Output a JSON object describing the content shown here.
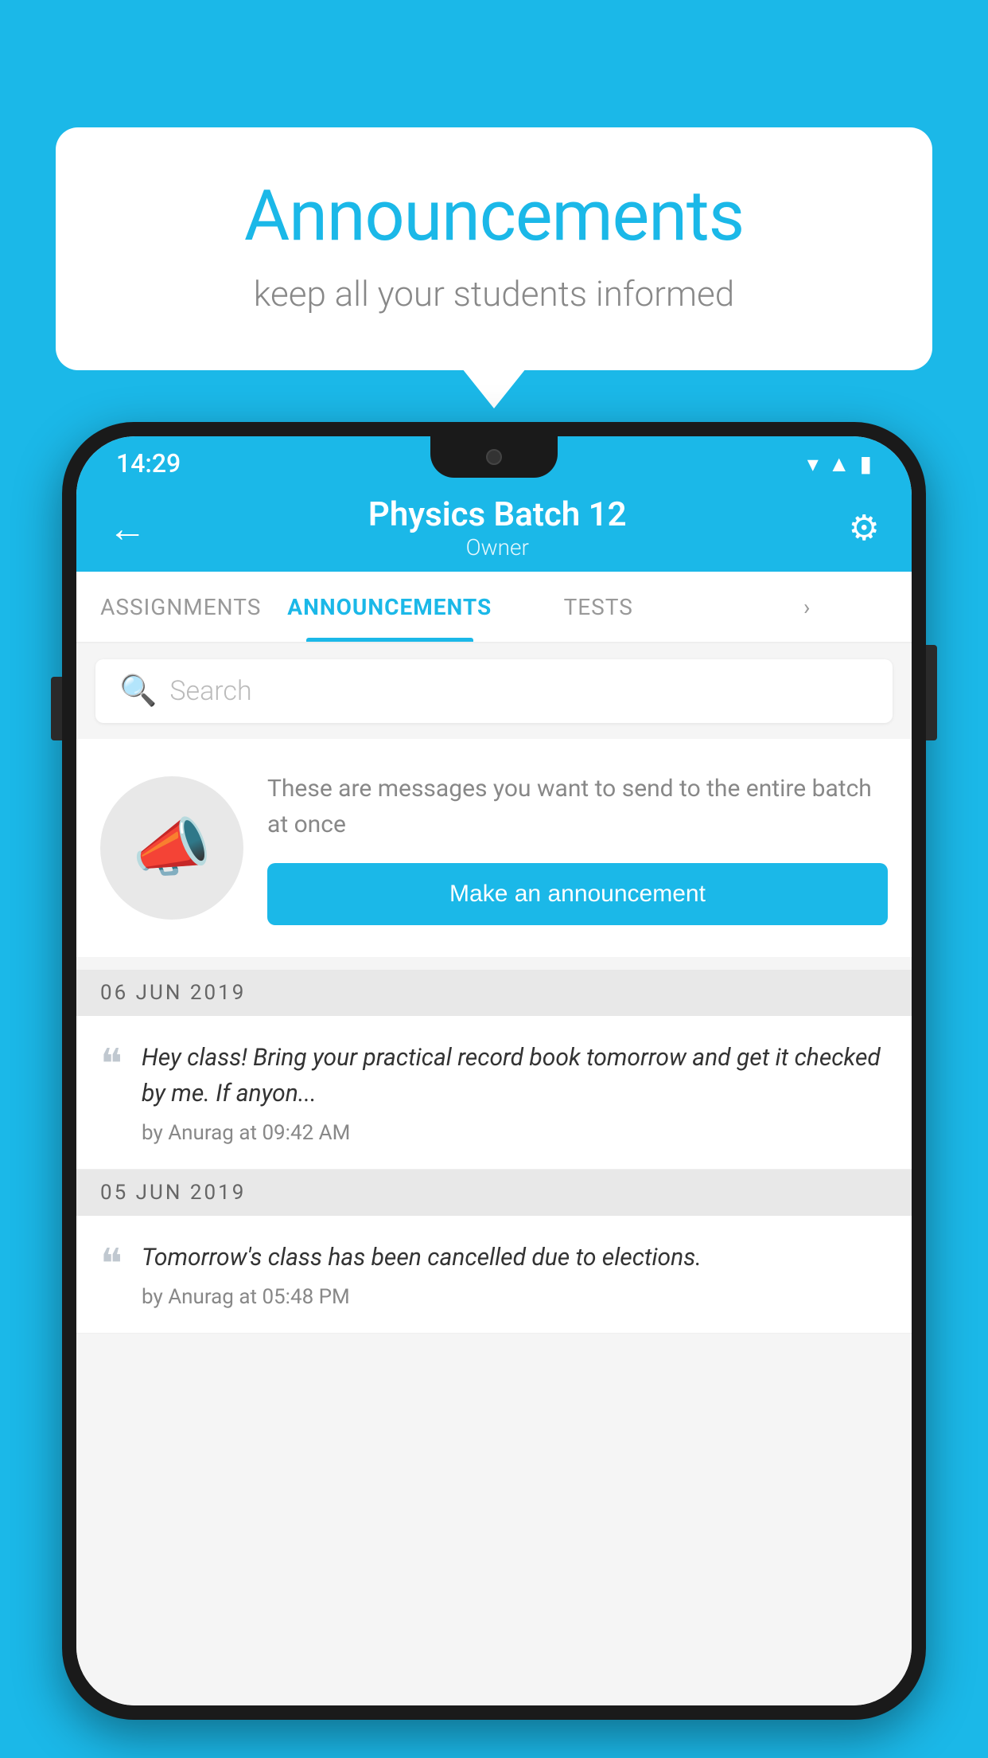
{
  "background_color": "#1BB8E8",
  "speech_bubble": {
    "title": "Announcements",
    "subtitle": "keep all your students informed"
  },
  "phone": {
    "status_bar": {
      "time": "14:29",
      "icons": [
        "wifi",
        "signal",
        "battery"
      ]
    },
    "header": {
      "back_label": "←",
      "title": "Physics Batch 12",
      "subtitle": "Owner",
      "settings_label": "⚙"
    },
    "tabs": [
      {
        "label": "ASSIGNMENTS",
        "active": false
      },
      {
        "label": "ANNOUNCEMENTS",
        "active": true
      },
      {
        "label": "TESTS",
        "active": false
      },
      {
        "label": "...",
        "active": false
      }
    ],
    "search": {
      "placeholder": "Search"
    },
    "promo": {
      "description": "These are messages you want to send to the entire batch at once",
      "button_label": "Make an announcement"
    },
    "announcements": [
      {
        "date": "06  JUN  2019",
        "items": [
          {
            "text": "Hey class! Bring your practical record book tomorrow and get it checked by me. If anyon...",
            "meta": "by Anurag at 09:42 AM"
          }
        ]
      },
      {
        "date": "05  JUN  2019",
        "items": [
          {
            "text": "Tomorrow's class has been cancelled due to elections.",
            "meta": "by Anurag at 05:48 PM"
          }
        ]
      }
    ]
  }
}
